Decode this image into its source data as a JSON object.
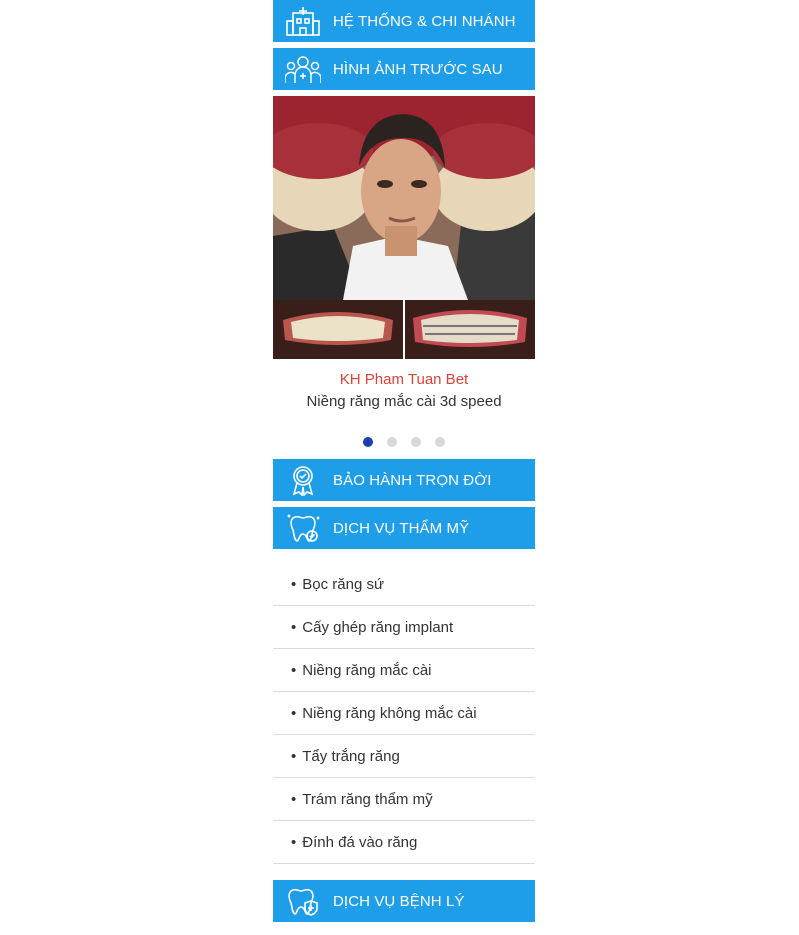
{
  "headers": {
    "system": "HỆ THỐNG & CHI NHÁNH",
    "before_after": "HÌNH ẢNH TRƯỚC SAU",
    "warranty": "BẢO HÀNH TRỌN ĐỜI",
    "cosmetic": "DỊCH VỤ THẨM MỸ",
    "pathology": "DỊCH VỤ BỆNH LÝ"
  },
  "slide": {
    "name": "KH Pham Tuan Bet",
    "desc": "Niềng răng mắc cài 3d speed",
    "total": 4,
    "active": 1
  },
  "services": [
    "Bọc răng sứ",
    "Cấy ghép răng implant",
    "Niềng răng mắc cài",
    "Niềng răng không mắc cài",
    "Tẩy trắng răng",
    "Trám răng thẩm mỹ",
    "Đính đá vào răng"
  ],
  "colors": {
    "accent": "#1e9ee9",
    "caption_name": "#d9443b",
    "dot_active": "#1a3faa"
  }
}
